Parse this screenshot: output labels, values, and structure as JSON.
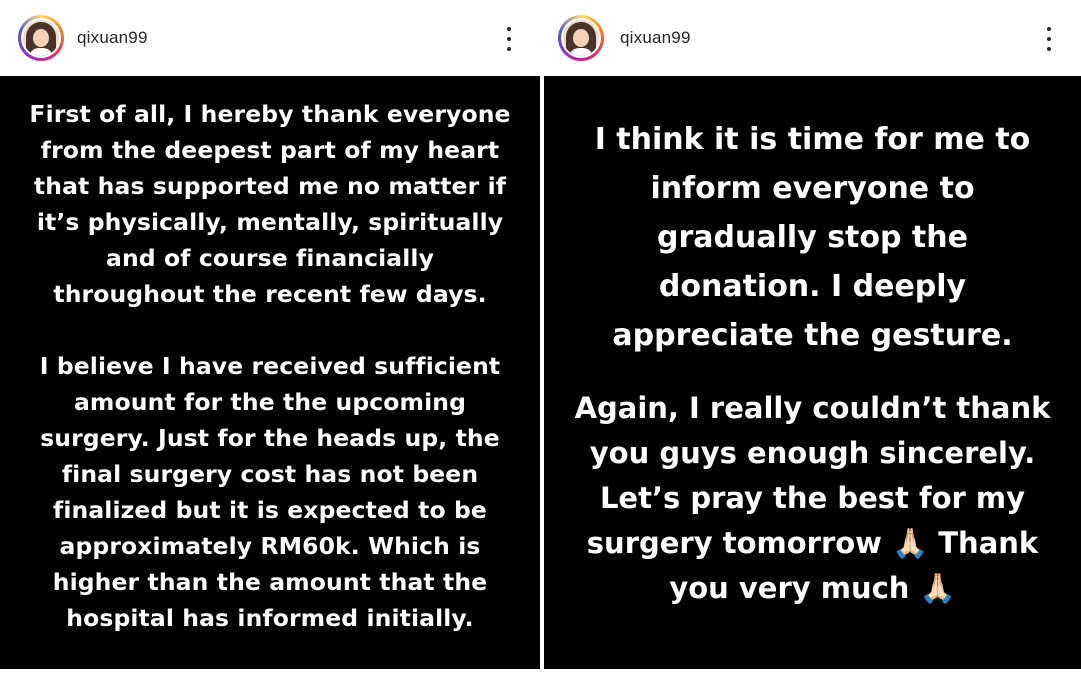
{
  "stories": [
    {
      "username": "qixuan99",
      "paragraphs": [
        "First of all, I hereby thank everyone\nfrom the deepest part of my heart\nthat has supported me no matter if\nit’s physically, mentally, spiritually\nand of course financially\nthroughout the recent few days.",
        "I believe I have received sufficient\namount for the the upcoming\nsurgery. Just for the heads up, the\nfinal surgery cost has not been\nfinalized but it is expected to be\napproximately RM60k. Which is\nhigher than the amount that the\nhospital has informed initially."
      ]
    },
    {
      "username": "qixuan99",
      "paragraphs": [
        "I think it is time for me to\ninform everyone to\ngradually stop the\ndonation. I deeply\nappreciate the gesture.",
        "Again, I really couldn’t thank\nyou guys enough sincerely.\nLet’s pray the best for my\nsurgery tomorrow 🙏🏻 Thank\nyou very much 🙏🏻"
      ]
    }
  ],
  "icons": {
    "more": "more-vertical-icon",
    "avatar": "profile-avatar",
    "emoji": "folded-hands-emoji"
  },
  "colors": {
    "story_background": "#000000",
    "story_text": "#ffffff",
    "header_background": "#ffffff",
    "username": "#262626"
  }
}
